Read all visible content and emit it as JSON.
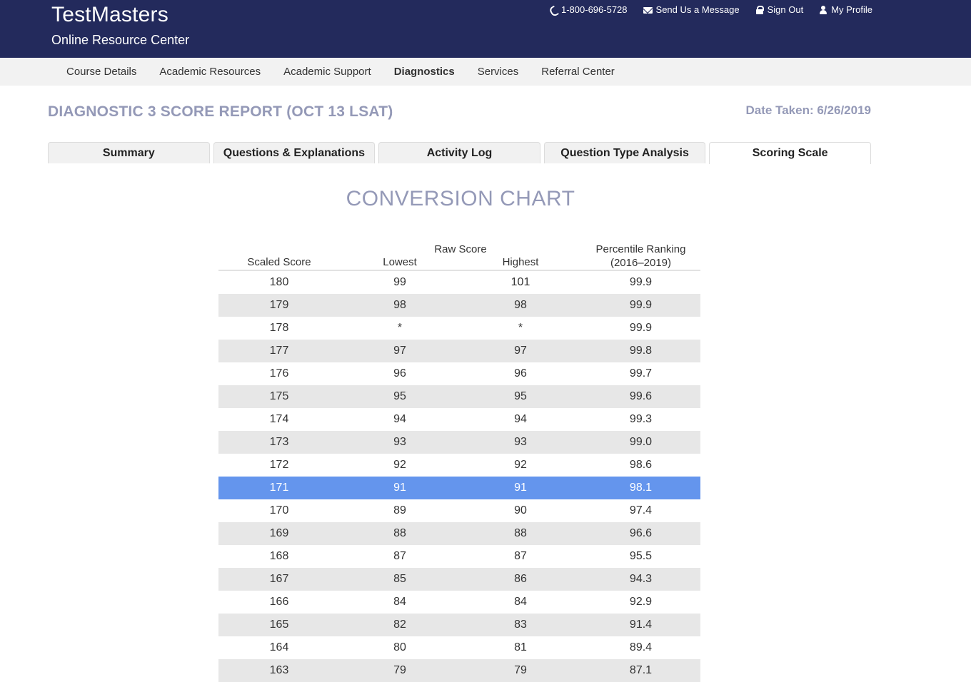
{
  "header": {
    "brand_title": "TestMasters",
    "brand_subtitle": "Online Resource Center",
    "links": [
      {
        "label": "1-800-696-5728",
        "icon": "phone-icon"
      },
      {
        "label": "Send Us a Message",
        "icon": "envelope-icon"
      },
      {
        "label": "Sign Out",
        "icon": "lock-icon"
      },
      {
        "label": "My Profile",
        "icon": "user-icon"
      }
    ],
    "bg_color": "#232a5c"
  },
  "nav": {
    "items": [
      "Course Details",
      "Academic Resources",
      "Academic Support",
      "Diagnostics",
      "Services",
      "Referral Center"
    ],
    "active": "Diagnostics"
  },
  "page": {
    "title": "DIAGNOSTIC 3 SCORE REPORT (OCT 13 LSAT)",
    "date_taken": "Date Taken: 6/26/2019"
  },
  "tabs": {
    "items": [
      "Summary",
      "Questions & Explanations",
      "Activity Log",
      "Question Type Analysis",
      "Scoring Scale"
    ],
    "active": "Scoring Scale"
  },
  "chart": {
    "title": "CONVERSION CHART",
    "headers": {
      "scaled": "Scaled Score",
      "raw": "Raw Score",
      "lowest": "Lowest",
      "highest": "Highest",
      "percentile_line1": "Percentile Ranking",
      "percentile_line2": "(2016–2019)"
    },
    "highlight_color": "#6495ed",
    "rows": [
      {
        "scaled": "180",
        "lowest": "99",
        "highest": "101",
        "pct": "99.9"
      },
      {
        "scaled": "179",
        "lowest": "98",
        "highest": "98",
        "pct": "99.9"
      },
      {
        "scaled": "178",
        "lowest": "*",
        "highest": "*",
        "pct": "99.9"
      },
      {
        "scaled": "177",
        "lowest": "97",
        "highest": "97",
        "pct": "99.8"
      },
      {
        "scaled": "176",
        "lowest": "96",
        "highest": "96",
        "pct": "99.7"
      },
      {
        "scaled": "175",
        "lowest": "95",
        "highest": "95",
        "pct": "99.6"
      },
      {
        "scaled": "174",
        "lowest": "94",
        "highest": "94",
        "pct": "99.3"
      },
      {
        "scaled": "173",
        "lowest": "93",
        "highest": "93",
        "pct": "99.0"
      },
      {
        "scaled": "172",
        "lowest": "92",
        "highest": "92",
        "pct": "98.6"
      },
      {
        "scaled": "171",
        "lowest": "91",
        "highest": "91",
        "pct": "98.1",
        "highlight": true
      },
      {
        "scaled": "170",
        "lowest": "89",
        "highest": "90",
        "pct": "97.4"
      },
      {
        "scaled": "169",
        "lowest": "88",
        "highest": "88",
        "pct": "96.6"
      },
      {
        "scaled": "168",
        "lowest": "87",
        "highest": "87",
        "pct": "95.5"
      },
      {
        "scaled": "167",
        "lowest": "85",
        "highest": "86",
        "pct": "94.3"
      },
      {
        "scaled": "166",
        "lowest": "84",
        "highest": "84",
        "pct": "92.9"
      },
      {
        "scaled": "165",
        "lowest": "82",
        "highest": "83",
        "pct": "91.4"
      },
      {
        "scaled": "164",
        "lowest": "80",
        "highest": "81",
        "pct": "89.4"
      },
      {
        "scaled": "163",
        "lowest": "79",
        "highest": "79",
        "pct": "87.1"
      }
    ]
  }
}
